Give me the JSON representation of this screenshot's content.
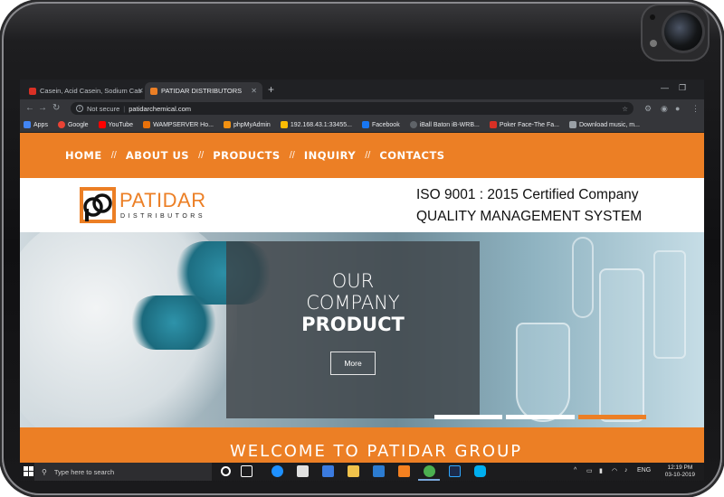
{
  "browser": {
    "tabs": [
      {
        "label": "Casein, Acid Casein, Sodium Casi",
        "favicon_color": "#d93025"
      },
      {
        "label": "PATIDAR DISTRIBUTORS",
        "favicon_color": "#ec7f25"
      }
    ],
    "new_tab": "+",
    "address": {
      "security": "Not secure",
      "url": "patidarchemical.com"
    },
    "bookmarks": [
      {
        "label": "Apps",
        "icon_color": "#4285f4"
      },
      {
        "label": "Google",
        "icon_color": "#ea4335"
      },
      {
        "label": "YouTube",
        "icon_color": "#ff0000"
      },
      {
        "label": "WAMPSERVER Ho...",
        "icon_color": "#e8710a"
      },
      {
        "label": "phpMyAdmin",
        "icon_color": "#f29111"
      },
      {
        "label": "192.168.43.1:33455...",
        "icon_color": "#fbbc04"
      },
      {
        "label": "Facebook",
        "icon_color": "#1877f2"
      },
      {
        "label": "iBall Baton iB-WRB...",
        "icon_color": "#5f6368"
      },
      {
        "label": "Poker Face-The Fa...",
        "icon_color": "#d93025"
      },
      {
        "label": "Download music, m...",
        "icon_color": "#9aa0a6"
      }
    ]
  },
  "site": {
    "nav": [
      "HOME",
      "ABOUT US",
      "PRODUCTS",
      "INQUIRY",
      "CONTACTS"
    ],
    "nav_separator": "//",
    "logo": {
      "name": "PATIDAR",
      "sub": "DISTRIBUTORS"
    },
    "iso_line1": "ISO 9001 : 2015 Certified Company",
    "iso_line2": "QUALITY MANAGEMENT SYSTEM",
    "hero": {
      "line1": "OUR",
      "line2": "COMPANY",
      "line3": "PRODUCT",
      "button": "More",
      "active_slide": 3,
      "slides": 3
    },
    "welcome": "WELCOME TO PATIDAR GROUP",
    "accent_color": "#ec7f25"
  },
  "taskbar": {
    "search_placeholder": "Type here to search",
    "language": "ENG",
    "time": "12:19 PM",
    "date": "03-10-2019"
  }
}
